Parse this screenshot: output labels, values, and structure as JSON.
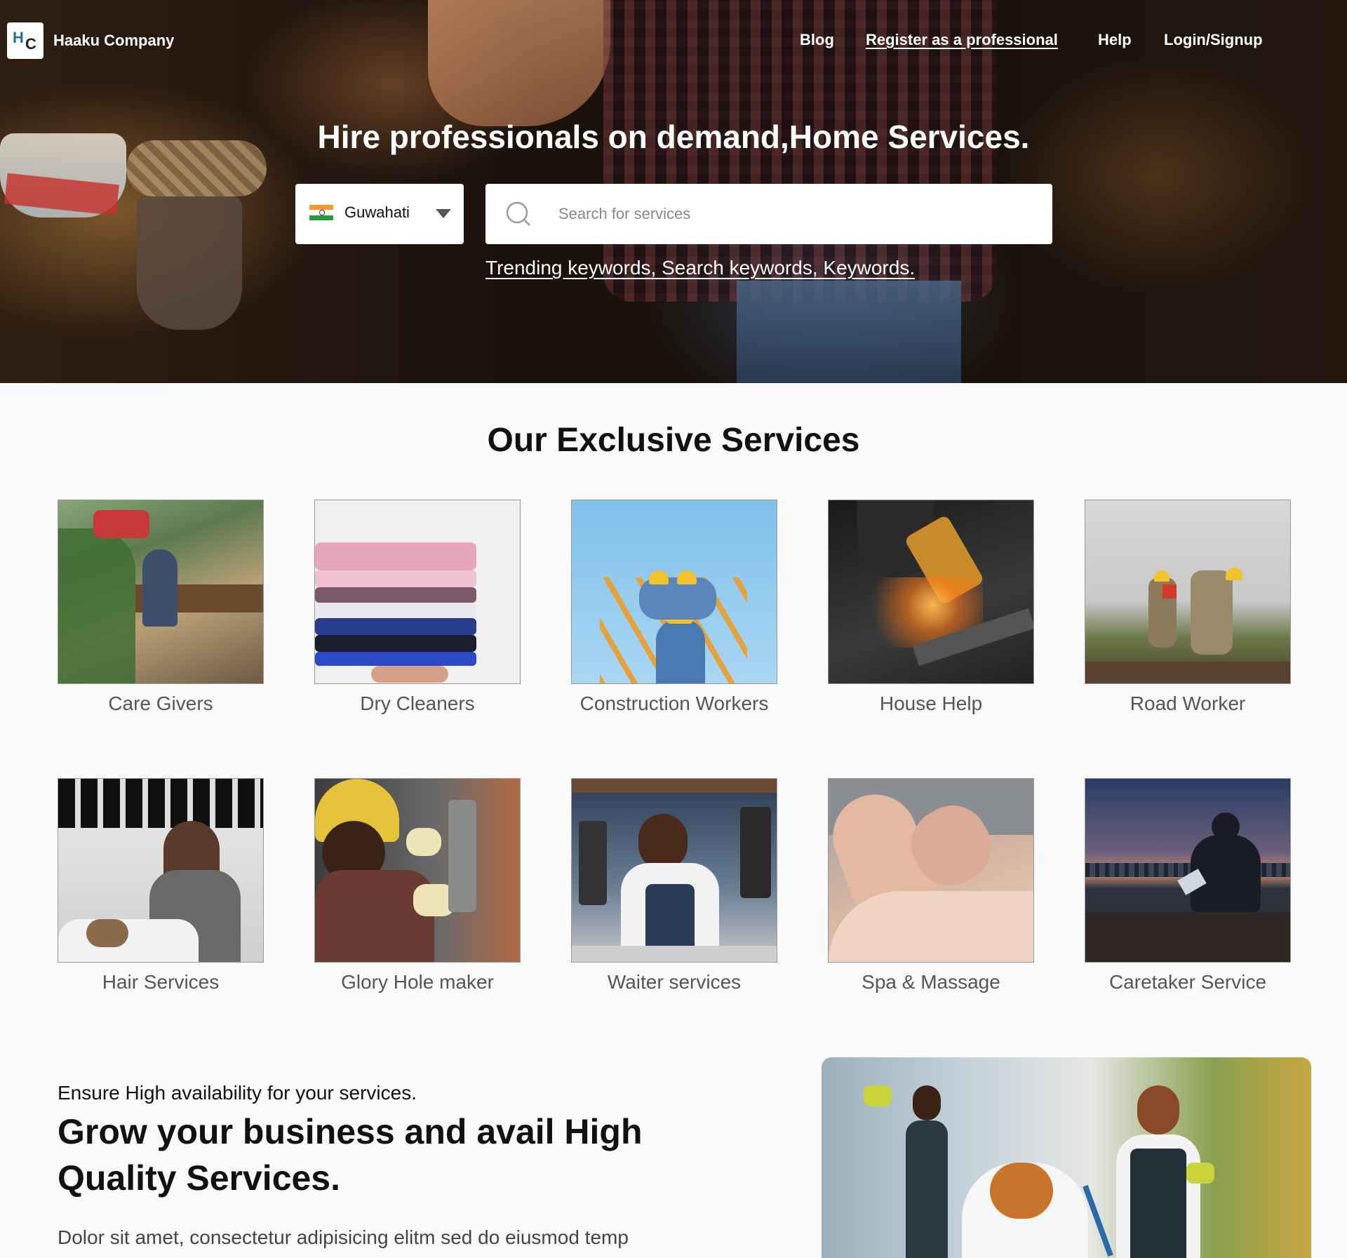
{
  "brand": {
    "logo_h": "H",
    "logo_c": "C",
    "name": "Haaku Company"
  },
  "nav": {
    "blog": "Blog",
    "register": "Register as a professional",
    "help": "Help",
    "login": "Login/Signup"
  },
  "hero": {
    "title": "Hire professionals on demand,Home Services.",
    "location": "Guwahati",
    "search_placeholder": "Search for services",
    "trending": "Trending keywords, Search keywords, Keywords."
  },
  "services": {
    "title": "Our Exclusive Services",
    "items": [
      {
        "label": "Care Givers"
      },
      {
        "label": "Dry Cleaners"
      },
      {
        "label": "Construction Workers"
      },
      {
        "label": "House Help"
      },
      {
        "label": "Road Worker"
      },
      {
        "label": "Hair Services"
      },
      {
        "label": "Glory Hole maker"
      },
      {
        "label": "Waiter services"
      },
      {
        "label": "Spa & Massage"
      },
      {
        "label": "Caretaker Service"
      }
    ]
  },
  "promo": {
    "kicker": "Ensure High availability for your services.",
    "headline": "Grow your business and avail High Quality Services.",
    "body": "Dolor sit amet, consectetur adipisicing elitm sed do eiusmod temp"
  }
}
